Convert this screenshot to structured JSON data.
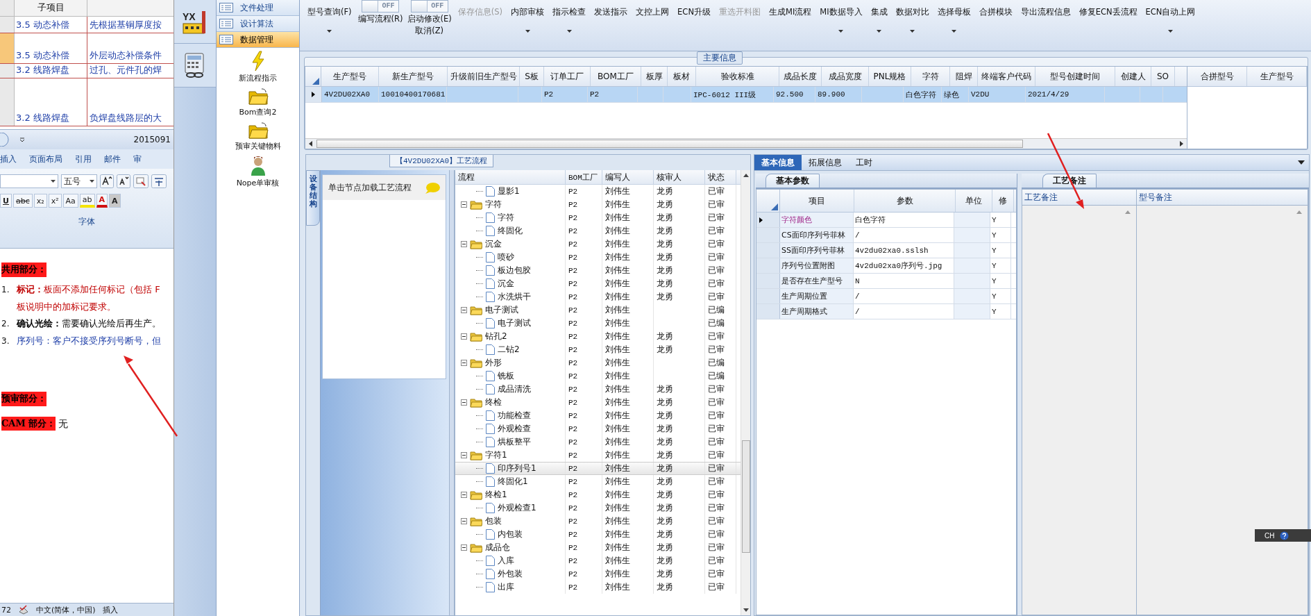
{
  "word": {
    "table": {
      "header": "子项目",
      "rows": [
        {
          "item": "3.5 动态补偿",
          "desc": "先根据基铜厚度按",
          "selected": false
        },
        {
          "item": "3.5 动态补偿",
          "desc": "外层动态补偿条件",
          "selected": true
        },
        {
          "item": "3.2 线路焊盘",
          "desc": "过孔、元件孔的焊",
          "selected": false
        },
        {
          "item": "3.2 线路焊盘",
          "desc": "负焊盘线路层的大",
          "selected": false
        }
      ]
    },
    "title": "2015091",
    "ribbon_tabs": [
      "插入",
      "页面布局",
      "引用",
      "邮件",
      "审"
    ],
    "font_size": "五号",
    "font_buttons": [
      {
        "kind": "underline",
        "label": "U"
      },
      {
        "kind": "strike",
        "label": "abc"
      },
      {
        "kind": "sub",
        "label": "x₂"
      },
      {
        "kind": "sup",
        "label": "x²"
      },
      {
        "kind": "case",
        "label": "Aa"
      },
      {
        "kind": "highlight",
        "label": "ab"
      },
      {
        "kind": "color",
        "label": "A"
      },
      {
        "kind": "shade",
        "label": "A"
      }
    ],
    "group_label": "字体",
    "paragraphs": [
      {
        "kind": "highlight",
        "text": "共用部分："
      },
      {
        "kind": "numbered",
        "number": "1.",
        "text": "**标记：**板面不添加任何标记（包括 F",
        "color": "#c00000"
      },
      {
        "kind": "continuation",
        "text": "板说明中的加标记要求。",
        "color": "#c00000"
      },
      {
        "kind": "numbered",
        "number": "2.",
        "text": "**确认光绘：**需要确认光绘后再生产。",
        "color": "#000000"
      },
      {
        "kind": "numbered",
        "number": "3.",
        "text": "序列号：客户不接受序列号断号，但",
        "color": "#1f3fa8"
      },
      {
        "kind": "blank"
      },
      {
        "kind": "highlight",
        "text": "预审部分："
      },
      {
        "kind": "highlight",
        "text": "CAM 部分：",
        "after": "无"
      }
    ],
    "status": [
      "72",
      "中文(简体，中国)",
      "插入"
    ]
  },
  "rail": {
    "logo": "YX"
  },
  "nav": [
    {
      "label": "文件处理",
      "selected": false
    },
    {
      "label": "设计算法",
      "selected": false
    },
    {
      "label": "数据管理",
      "selected": true
    }
  ],
  "tools": [
    {
      "kind": "bolt",
      "label": "新流程指示"
    },
    {
      "kind": "folder",
      "label": "Bom查询2"
    },
    {
      "kind": "folder",
      "label": "预审关键物料"
    },
    {
      "kind": "person",
      "label": "Nope单审核"
    }
  ],
  "toolbar": [
    {
      "kind": "button",
      "label": "型号查询(F)",
      "dropdown": true,
      "disabled": false
    },
    {
      "kind": "toggle",
      "state": "OFF",
      "on": false,
      "label": "编写流程(R)"
    },
    {
      "kind": "toggle",
      "state": "OFF",
      "on": false,
      "label": "启动修改(E)",
      "sub": "取消(Z)"
    },
    {
      "kind": "button",
      "label": "保存信息(S)",
      "dropdown": false,
      "disabled": true
    },
    {
      "kind": "button",
      "label": "内部审核",
      "dropdown": true,
      "disabled": false
    },
    {
      "kind": "button",
      "label": "指示检查",
      "dropdown": true,
      "disabled": false
    },
    {
      "kind": "button",
      "label": "发送指示",
      "dropdown": false,
      "disabled": false
    },
    {
      "kind": "button",
      "label": "文控上网",
      "dropdown": false,
      "disabled": false
    },
    {
      "kind": "button",
      "label": "ECN升级",
      "dropdown": false,
      "disabled": false
    },
    {
      "kind": "button",
      "label": "重选开料图",
      "dropdown": false,
      "disabled": true
    },
    {
      "kind": "button",
      "label": "生成MI流程",
      "dropdown": false,
      "disabled": false
    },
    {
      "kind": "button",
      "label": "MI数据导入",
      "dropdown": true,
      "disabled": false
    },
    {
      "kind": "button",
      "label": "集成",
      "dropdown": true,
      "disabled": false
    },
    {
      "kind": "button",
      "label": "数据对比",
      "dropdown": true,
      "disabled": false
    },
    {
      "kind": "button",
      "label": "选择母板",
      "dropdown": true,
      "disabled": false
    },
    {
      "kind": "button",
      "label": "合拼模块",
      "dropdown": false,
      "disabled": false
    },
    {
      "kind": "button",
      "label": "导出流程信息",
      "dropdown": false,
      "disabled": false
    },
    {
      "kind": "button",
      "label": "修复ECN丢流程",
      "dropdown": false,
      "disabled": false
    },
    {
      "kind": "button",
      "label": "ECN自动上网",
      "dropdown": true,
      "disabled": false
    }
  ],
  "main_info": {
    "title": "主要信息",
    "columns": [
      "生产型号",
      "新生产型号",
      "升级前旧生产型号",
      "S板",
      "订单工厂",
      "BOM工厂",
      "板厚",
      "板材",
      "验收标准",
      "成品长度",
      "成品宽度",
      "PNL规格",
      "字符",
      "阻焊",
      "终端客户代码",
      "型号创建时间",
      "创建人",
      "SO"
    ],
    "rows": [
      {
        "selected": true,
        "cells": [
          "4V2DU02XA0",
          "10010400170681",
          null,
          null,
          "P2",
          "P2",
          null,
          null,
          "IPC-6012 III级",
          "92.500",
          "89.900",
          null,
          "白色字符",
          "绿色",
          "V2DU",
          "2021/4/29",
          null,
          null
        ]
      }
    ],
    "side_columns": [
      "合拼型号",
      "生产型号"
    ]
  },
  "flow": {
    "title": "【4V2DU02XA0】工艺流程",
    "side_tab": "设备结构",
    "hint": "单击节点加载工艺流程",
    "columns": [
      "流程",
      "BOM工厂",
      "编写人",
      "核审人",
      "状态"
    ],
    "tree": [
      {
        "children": [
          {
            "name": "显影1",
            "bom": "P2",
            "writer": "刘伟生",
            "reviewer": "龙勇",
            "status": "已审",
            "selected": false
          }
        ]
      },
      {
        "name": "字符",
        "bom": "P2",
        "writer": "刘伟生",
        "reviewer": "龙勇",
        "status": "已审",
        "selected": false,
        "expanded": true,
        "children": [
          {
            "name": "字符",
            "bom": "P2",
            "writer": "刘伟生",
            "reviewer": "龙勇",
            "status": "已审",
            "selected": false
          },
          {
            "name": "终固化",
            "bom": "P2",
            "writer": "刘伟生",
            "reviewer": "龙勇",
            "status": "已审",
            "selected": false
          }
        ]
      },
      {
        "name": "沉金",
        "bom": "P2",
        "writer": "刘伟生",
        "reviewer": "龙勇",
        "status": "已审",
        "selected": false,
        "expanded": true,
        "children": [
          {
            "name": "喷砂",
            "bom": "P2",
            "writer": "刘伟生",
            "reviewer": "龙勇",
            "status": "已审",
            "selected": false
          },
          {
            "name": "板边包胶",
            "bom": "P2",
            "writer": "刘伟生",
            "reviewer": "龙勇",
            "status": "已审",
            "selected": false
          },
          {
            "name": "沉金",
            "bom": "P2",
            "writer": "刘伟生",
            "reviewer": "龙勇",
            "status": "已审",
            "selected": false
          },
          {
            "name": "水洗烘干",
            "bom": "P2",
            "writer": "刘伟生",
            "reviewer": "龙勇",
            "status": "已审",
            "selected": false
          }
        ]
      },
      {
        "name": "电子测试",
        "bom": "P2",
        "writer": "刘伟生",
        "status": "已编",
        "selected": false,
        "expanded": true,
        "children": [
          {
            "name": "电子测试",
            "bom": "P2",
            "writer": "刘伟生",
            "status": "已编",
            "selected": false
          }
        ]
      },
      {
        "name": "钻孔2",
        "bom": "P2",
        "writer": "刘伟生",
        "reviewer": "龙勇",
        "status": "已审",
        "selected": false,
        "expanded": true,
        "children": [
          {
            "name": "二钻2",
            "bom": "P2",
            "writer": "刘伟生",
            "reviewer": "龙勇",
            "status": "已审",
            "selected": false
          }
        ]
      },
      {
        "name": "外形",
        "bom": "P2",
        "writer": "刘伟生",
        "status": "已编",
        "selected": false,
        "expanded": true,
        "children": [
          {
            "name": "铣板",
            "bom": "P2",
            "writer": "刘伟生",
            "status": "已编",
            "selected": false
          },
          {
            "name": "成品清洗",
            "bom": "P2",
            "writer": "刘伟生",
            "reviewer": "龙勇",
            "status": "已审",
            "selected": false
          }
        ]
      },
      {
        "name": "终检",
        "bom": "P2",
        "writer": "刘伟生",
        "reviewer": "龙勇",
        "status": "已审",
        "selected": false,
        "expanded": true,
        "children": [
          {
            "name": "功能检查",
            "bom": "P2",
            "writer": "刘伟生",
            "reviewer": "龙勇",
            "status": "已审",
            "selected": false
          },
          {
            "name": "外观检查",
            "bom": "P2",
            "writer": "刘伟生",
            "reviewer": "龙勇",
            "status": "已审",
            "selected": false
          },
          {
            "name": "烘板整平",
            "bom": "P2",
            "writer": "刘伟生",
            "reviewer": "龙勇",
            "status": "已审",
            "selected": false
          }
        ]
      },
      {
        "name": "字符1",
        "bom": "P2",
        "writer": "刘伟生",
        "reviewer": "龙勇",
        "status": "已审",
        "selected": false,
        "expanded": true,
        "children": [
          {
            "name": "印序列号1",
            "bom": "P2",
            "writer": "刘伟生",
            "reviewer": "龙勇",
            "status": "已审",
            "selected": true
          },
          {
            "name": "终固化1",
            "bom": "P2",
            "writer": "刘伟生",
            "reviewer": "龙勇",
            "status": "已审",
            "selected": false
          }
        ]
      },
      {
        "name": "终检1",
        "bom": "P2",
        "writer": "刘伟生",
        "reviewer": "龙勇",
        "status": "已审",
        "selected": false,
        "expanded": true,
        "children": [
          {
            "name": "外观检查1",
            "bom": "P2",
            "writer": "刘伟生",
            "reviewer": "龙勇",
            "status": "已审",
            "selected": false
          }
        ]
      },
      {
        "name": "包装",
        "bom": "P2",
        "writer": "刘伟生",
        "reviewer": "龙勇",
        "status": "已审",
        "selected": false,
        "expanded": true,
        "children": [
          {
            "name": "内包装",
            "bom": "P2",
            "writer": "刘伟生",
            "reviewer": "龙勇",
            "status": "已审",
            "selected": false
          }
        ]
      },
      {
        "name": "成品仓",
        "bom": "P2",
        "writer": "刘伟生",
        "reviewer": "龙勇",
        "status": "已审",
        "selected": false,
        "expanded": true,
        "children": [
          {
            "name": "入库",
            "bom": "P2",
            "writer": "刘伟生",
            "reviewer": "龙勇",
            "status": "已审",
            "selected": false
          },
          {
            "name": "外包装",
            "bom": "P2",
            "writer": "刘伟生",
            "reviewer": "龙勇",
            "status": "已审",
            "selected": false
          },
          {
            "name": "出库",
            "bom": "P2",
            "writer": "刘伟生",
            "reviewer": "龙勇",
            "status": "已审",
            "selected": false
          }
        ]
      }
    ]
  },
  "detail": {
    "tabs": [
      {
        "label": "基本信息",
        "selected": true
      },
      {
        "label": "拓展信息",
        "selected": false
      },
      {
        "label": "工时",
        "selected": false
      }
    ],
    "params_tab": "基本参数",
    "param_columns": [
      "项目",
      "参数",
      "单位",
      "修"
    ],
    "params": [
      {
        "item": "字符颜色",
        "value": "白色字符",
        "flag": "Y",
        "selected": true
      },
      {
        "item": "CS面印序列号菲林",
        "value": "/",
        "flag": "Y",
        "selected": false
      },
      {
        "item": "SS面印序列号菲林",
        "value": "4v2du02xa0.sslsh",
        "flag": "Y",
        "selected": false
      },
      {
        "item": "序列号位置附图",
        "value": "4v2du02xa0序列号.jpg",
        "flag": "Y",
        "selected": false
      },
      {
        "item": "是否存在生产型号",
        "value": "N",
        "flag": "Y",
        "selected": false
      },
      {
        "item": "生产周期位置",
        "value": "/",
        "flag": "Y",
        "selected": false
      },
      {
        "item": "生产周期格式",
        "value": "/",
        "flag": "Y",
        "selected": false
      }
    ],
    "remarks_tab": "工艺备注",
    "remark_columns": [
      "工艺备注",
      "型号备注"
    ]
  },
  "language_bar": {
    "label": "CH"
  }
}
